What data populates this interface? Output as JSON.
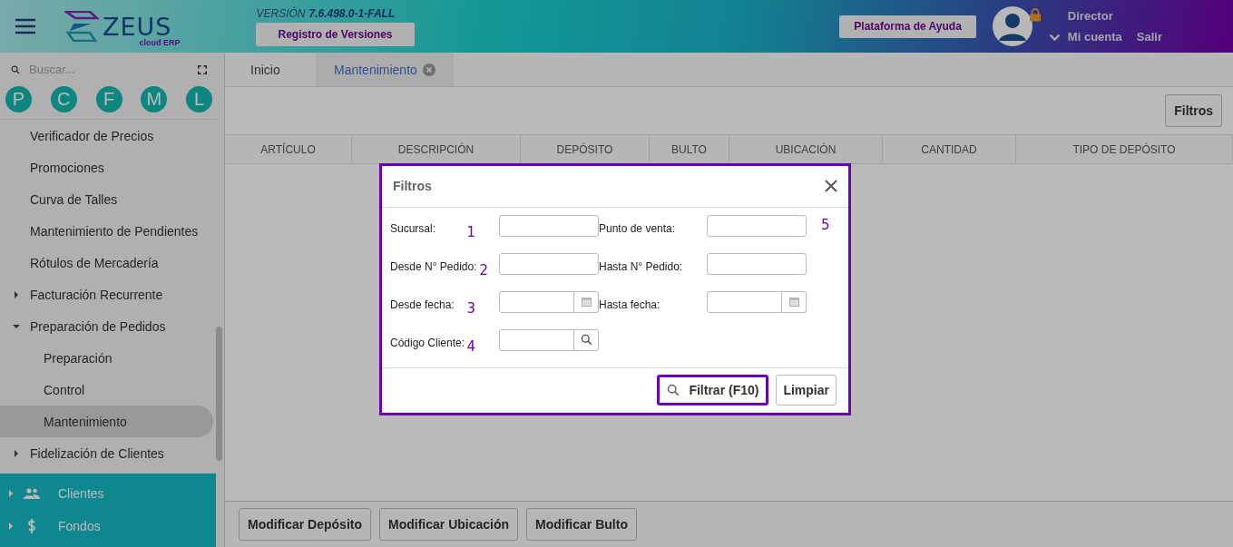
{
  "header": {
    "logo": {
      "name": "ZEUS",
      "sub": "cloud ERP"
    },
    "version_label": "VERSIÓN",
    "version": "7.6.498.0-1-FALL",
    "versions_button": "Registro de Versiones",
    "help_button": "Plataforma de Ayuda",
    "user": {
      "role": "Director",
      "account_link": "Mi cuenta",
      "logout_link": "Salir",
      "locked": true
    }
  },
  "sidebar": {
    "search_placeholder": "Buscar...",
    "shortcuts": [
      "P",
      "C",
      "F",
      "M",
      "L"
    ],
    "items": [
      {
        "label": "Verificador de Precios",
        "selected": false
      },
      {
        "label": "Promociones",
        "selected": false
      },
      {
        "label": "Curva de Talles",
        "selected": false
      },
      {
        "label": "Mantenimiento de Pendientes",
        "selected": false
      },
      {
        "label": "Rótulos de Mercadería",
        "selected": false
      },
      {
        "label": "Facturación Recurrente",
        "selected": false,
        "expanded": false
      },
      {
        "label": "Preparación de Pedidos",
        "selected": false,
        "expanded": true,
        "children": [
          {
            "label": "Preparación",
            "selected": false
          },
          {
            "label": "Control",
            "selected": false
          },
          {
            "label": "Mantenimiento",
            "selected": true
          }
        ]
      },
      {
        "label": "Fidelización de Clientes",
        "selected": false,
        "expanded": false
      }
    ],
    "modules": [
      {
        "label": "Clientes",
        "kind": "people",
        "expanded": false
      },
      {
        "label": "Fondos",
        "kind": "money",
        "expanded": false
      }
    ]
  },
  "tabs": [
    {
      "label": "Inicio",
      "selected": false,
      "closable": false
    },
    {
      "label": "Mantenimiento",
      "selected": true,
      "closable": true
    }
  ],
  "toolbar": {
    "filters_button": "Filtros"
  },
  "table": {
    "columns": [
      "ARTÍCULO",
      "DESCRIPCIÓN",
      "DEPÓSITO",
      "BULTO",
      "UBICACIÓN",
      "CANTIDAD",
      "TIPO DE DEPÓSITO"
    ]
  },
  "actions": [
    "Modificar Depósito",
    "Modificar Ubicación",
    "Modificar Bulto"
  ],
  "dialog": {
    "title": "Filtros",
    "rows": [
      {
        "fields": [
          {
            "label": "Sucursal:",
            "kind": "text",
            "note": "1"
          },
          {
            "label": "Punto de venta:",
            "kind": "text"
          }
        ],
        "note": "5"
      },
      {
        "fields": [
          {
            "label": "Desde N° Pedido:",
            "kind": "text",
            "note": "2"
          },
          {
            "label": "Hasta N° Pedido:",
            "kind": "text"
          }
        ]
      },
      {
        "fields": [
          {
            "label": "Desde fecha:",
            "kind": "date",
            "note": "3"
          },
          {
            "label": "Hasta fecha:",
            "kind": "date"
          }
        ]
      },
      {
        "fields": [
          {
            "label": "Código Cliente:",
            "kind": "lookup",
            "note": "4"
          }
        ]
      }
    ],
    "buttons": [
      {
        "label": "Filtrar (F10)",
        "kind": "search",
        "highlighted": true
      },
      {
        "label": "Limpiar",
        "kind": "plain",
        "highlighted": false
      }
    ]
  }
}
